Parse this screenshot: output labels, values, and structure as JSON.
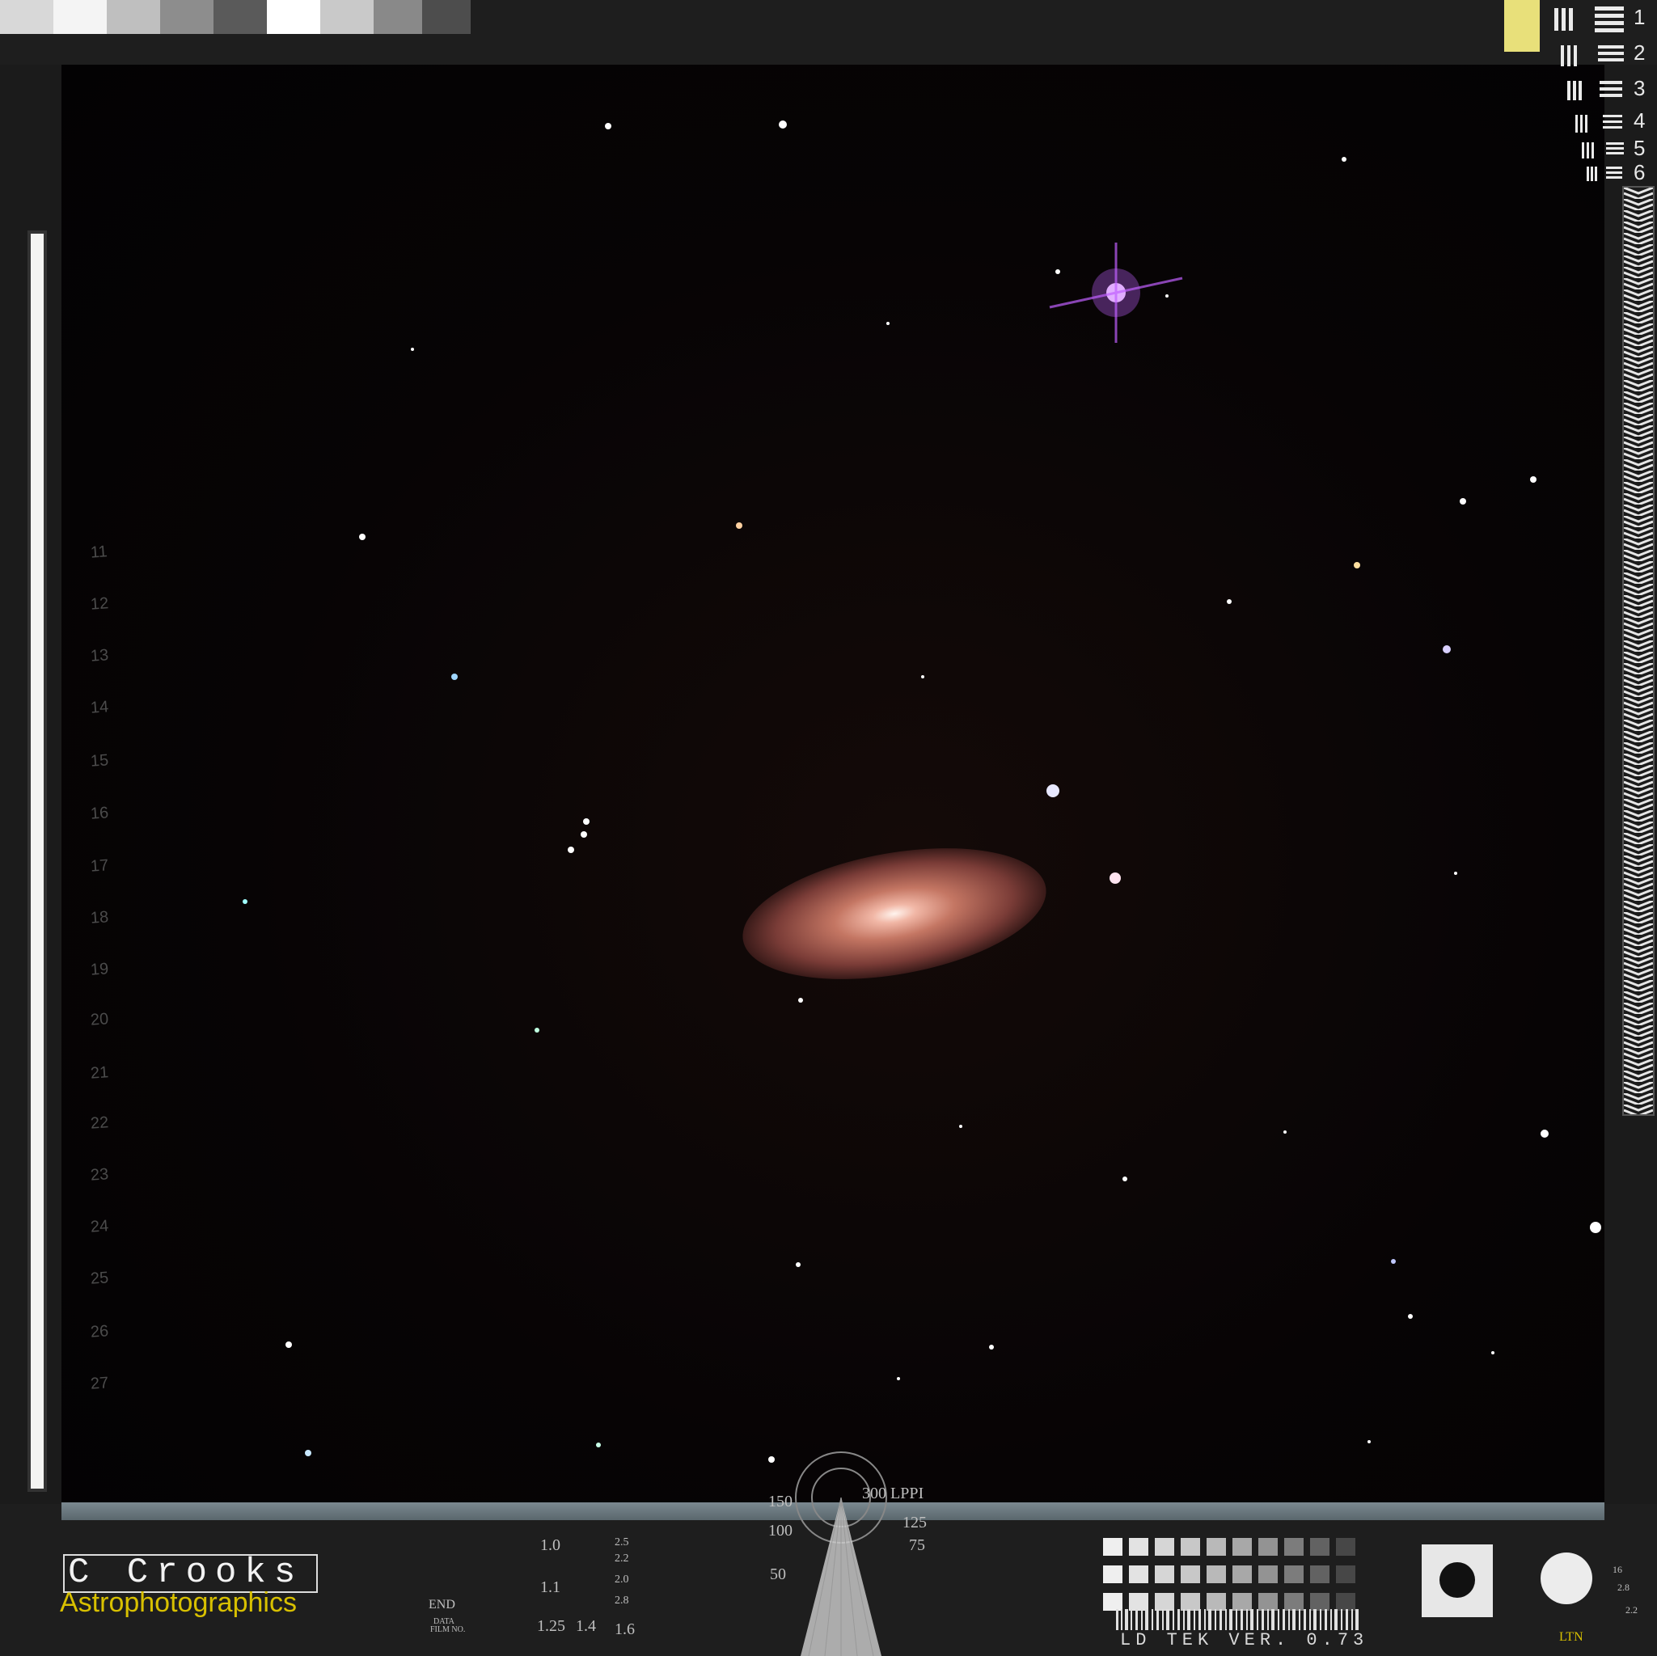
{
  "watermark": {
    "name": "C Crooks",
    "subtitle": "Astrophotographics"
  },
  "ruler": {
    "labels": [
      "11",
      "12",
      "13",
      "14",
      "15",
      "16",
      "17",
      "18",
      "19",
      "20",
      "21",
      "22",
      "23",
      "24",
      "25",
      "26",
      "27"
    ]
  },
  "resolution_chart": {
    "numbers": [
      "1",
      "2",
      "3",
      "4",
      "5",
      "6"
    ]
  },
  "bottom_target": {
    "lpi_label": "300 LPPI",
    "values": [
      "150",
      "100",
      "50",
      "125",
      "75"
    ],
    "scale_labels": [
      "1.0",
      "1.1",
      "1.25",
      "1.4",
      "1.6",
      "2.0",
      "2.2",
      "2.5",
      "2.8"
    ],
    "end_label": "END",
    "data_label": "DATA",
    "filmno_label": "FILM NO."
  },
  "footer": {
    "version": "LD TEK VER. 0.73",
    "mark": "LTN",
    "small_numbers": [
      "16",
      "2.8",
      "2.2"
    ]
  },
  "colors": {
    "frame": "#1b1b1b",
    "sky": "#050304",
    "galaxy_core": "#f1b7a6",
    "logo_yellow": "#d8c000",
    "star_magenta": "#d070ff"
  }
}
